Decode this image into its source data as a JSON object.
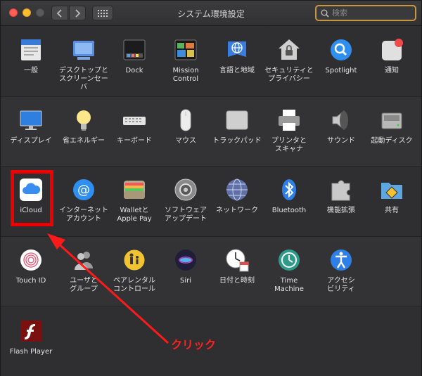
{
  "window": {
    "title": "システム環境設定",
    "search_placeholder": "検索"
  },
  "rows": [
    [
      {
        "id": "general",
        "label": "一般",
        "icon": "general-icon"
      },
      {
        "id": "desktop",
        "label": "デスクトップと\nスクリーンセーバ",
        "icon": "desktop-icon"
      },
      {
        "id": "dock",
        "label": "Dock",
        "icon": "dock-icon"
      },
      {
        "id": "mission",
        "label": "Mission\nControl",
        "icon": "mission-control-icon"
      },
      {
        "id": "language",
        "label": "言語と地域",
        "icon": "language-region-icon"
      },
      {
        "id": "security",
        "label": "セキュリティと\nプライバシー",
        "icon": "security-icon"
      },
      {
        "id": "spotlight",
        "label": "Spotlight",
        "icon": "spotlight-icon"
      },
      {
        "id": "notifications",
        "label": "通知",
        "icon": "notifications-icon"
      }
    ],
    [
      {
        "id": "displays",
        "label": "ディスプレイ",
        "icon": "display-icon"
      },
      {
        "id": "energy",
        "label": "省エネルギー",
        "icon": "energy-saver-icon"
      },
      {
        "id": "keyboard",
        "label": "キーボード",
        "icon": "keyboard-icon"
      },
      {
        "id": "mouse",
        "label": "マウス",
        "icon": "mouse-icon"
      },
      {
        "id": "trackpad",
        "label": "トラックパッド",
        "icon": "trackpad-icon"
      },
      {
        "id": "printers",
        "label": "プリンタと\nスキャナ",
        "icon": "printer-icon"
      },
      {
        "id": "sound",
        "label": "サウンド",
        "icon": "sound-icon"
      },
      {
        "id": "startup",
        "label": "起動ディスク",
        "icon": "startup-disk-icon"
      }
    ],
    [
      {
        "id": "icloud",
        "label": "iCloud",
        "icon": "icloud-icon"
      },
      {
        "id": "internet",
        "label": "インターネット\nアカウント",
        "icon": "internet-accounts-icon"
      },
      {
        "id": "wallet",
        "label": "Walletと\nApple Pay",
        "icon": "wallet-icon"
      },
      {
        "id": "update",
        "label": "ソフトウェア\nアップデート",
        "icon": "software-update-icon"
      },
      {
        "id": "network",
        "label": "ネットワーク",
        "icon": "network-icon"
      },
      {
        "id": "bluetooth",
        "label": "Bluetooth",
        "icon": "bluetooth-icon"
      },
      {
        "id": "extensions",
        "label": "機能拡張",
        "icon": "extensions-icon"
      },
      {
        "id": "sharing",
        "label": "共有",
        "icon": "sharing-icon"
      }
    ],
    [
      {
        "id": "touchid",
        "label": "Touch ID",
        "icon": "touch-id-icon"
      },
      {
        "id": "users",
        "label": "ユーザと\nグループ",
        "icon": "users-groups-icon"
      },
      {
        "id": "parental",
        "label": "ペアレンタル\nコントロール",
        "icon": "parental-controls-icon"
      },
      {
        "id": "siri",
        "label": "Siri",
        "icon": "siri-icon"
      },
      {
        "id": "datetime",
        "label": "日付と時刻",
        "icon": "date-time-icon"
      },
      {
        "id": "timemachine",
        "label": "Time\nMachine",
        "icon": "time-machine-icon"
      },
      {
        "id": "accessibility",
        "label": "アクセシ\nビリティ",
        "icon": "accessibility-icon"
      }
    ],
    [
      {
        "id": "flash",
        "label": "Flash Player",
        "icon": "flash-player-icon"
      }
    ]
  ],
  "annotation": {
    "text": "クリック",
    "color": "#ff2020"
  }
}
